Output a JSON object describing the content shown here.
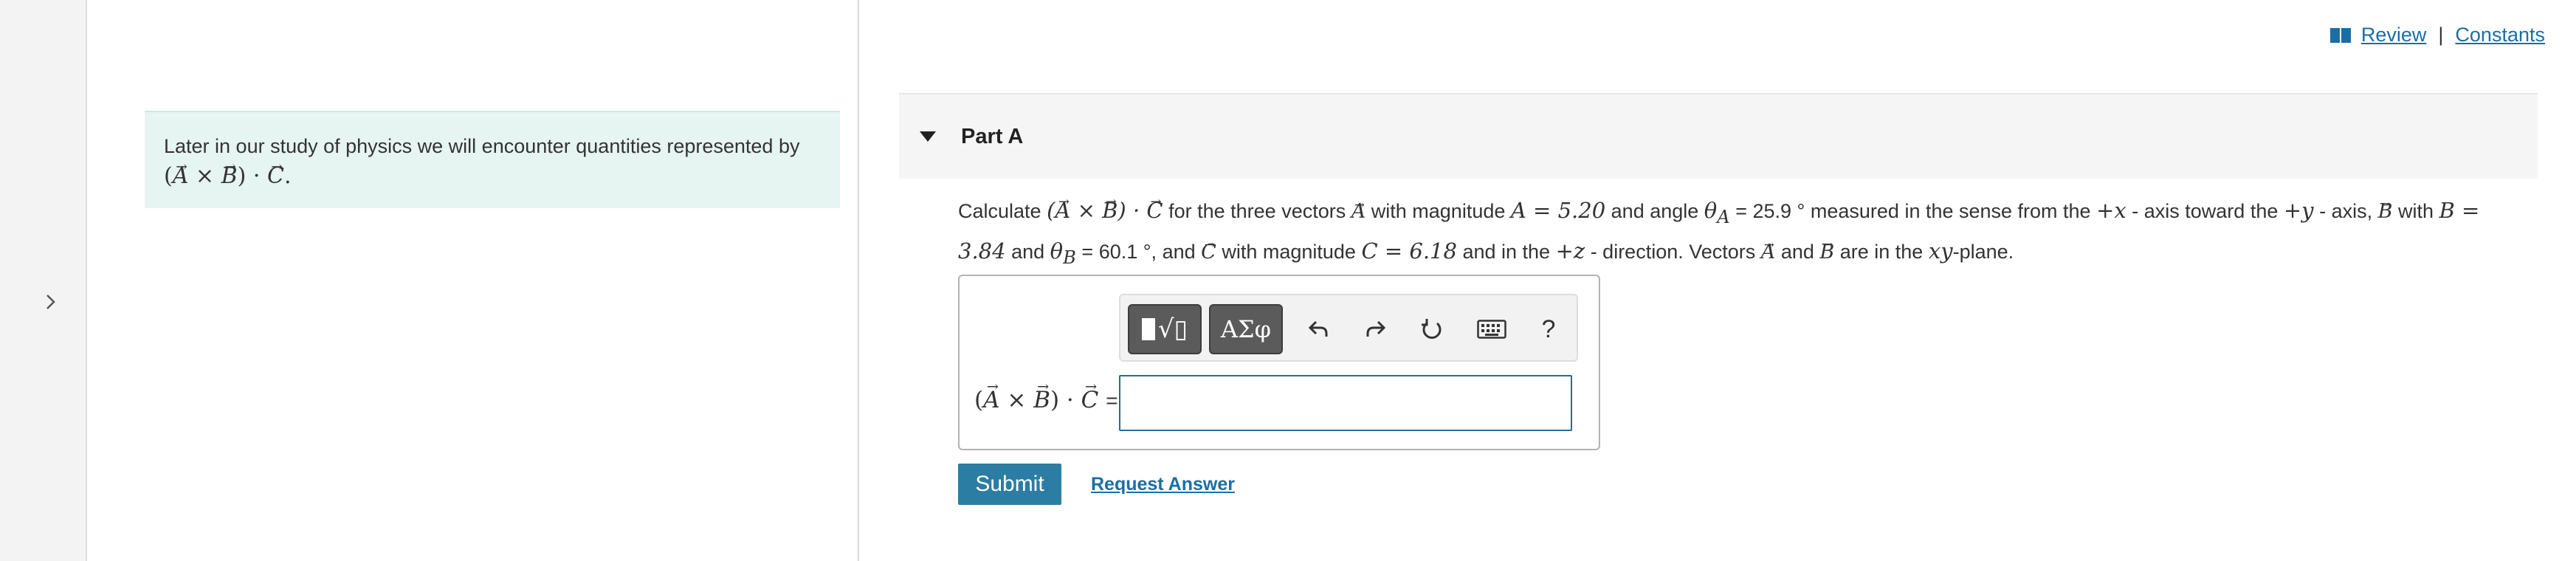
{
  "intro": {
    "text": "Later in our study of physics we will encounter quantities represented by",
    "expression": "(A × B) · C."
  },
  "links": {
    "review": "Review",
    "separator": "|",
    "constants": "Constants"
  },
  "part": {
    "title": "Part A"
  },
  "question": {
    "t1": "Calculate",
    "t2": "for the three vectors",
    "t3": "with magnitude",
    "A_eq": "A = 5.20",
    "t4": "and angle",
    "thetaA_eq": "θ",
    "thetaA_sub": "A",
    "thetaA_val": "= 25.9 °",
    "t5": "measured in the sense from the",
    "plus_x": "+x",
    "t6": "- axis toward the",
    "plus_y": "+y",
    "t7": "- axis,",
    "t8": "with",
    "B_eq": "B = 3.84",
    "t9": "and",
    "thetaB_eq": "θ",
    "thetaB_sub": "B",
    "thetaB_val": "= 60.1 °,",
    "t10": "and",
    "t11": "with magnitude",
    "C_eq": "C = 6.18",
    "t12": "and in the",
    "plus_z": "+z",
    "t13": "- direction. Vectors",
    "t14": "and",
    "t15": "are in the",
    "xy": "xy",
    "t16": "-plane."
  },
  "toolbar": {
    "templates_icon": "templates-icon",
    "greek_label": "ΑΣφ",
    "help_label": "?"
  },
  "answer": {
    "label_suffix": "=",
    "value": ""
  },
  "actions": {
    "submit_label": "Submit",
    "request_label": "Request Answer"
  },
  "colors": {
    "accent": "#2b7da3",
    "link": "#1a6ea6",
    "intro_bg": "#e6f4f2",
    "header_bg": "#f5f5f5"
  }
}
